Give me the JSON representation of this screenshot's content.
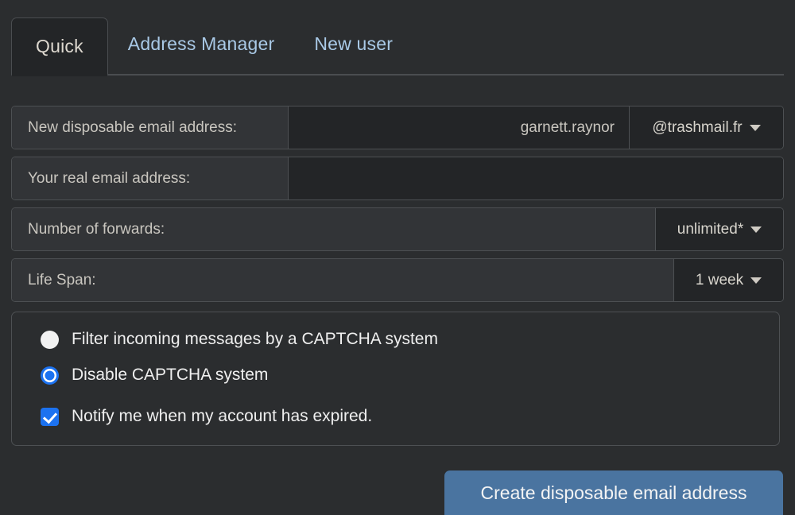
{
  "tabs": [
    {
      "label": "Quick",
      "active": true
    },
    {
      "label": "Address Manager",
      "active": false
    },
    {
      "label": "New user",
      "active": false
    }
  ],
  "form": {
    "new_address": {
      "label": "New disposable email address:",
      "value": "garnett.raynor",
      "placeholder": "",
      "domain_selected": "@trashmail.fr"
    },
    "real_address": {
      "label": "Your real email address:",
      "value": "",
      "placeholder": ""
    },
    "forwards": {
      "label": "Number of forwards:",
      "selected": "unlimited*"
    },
    "lifespan": {
      "label": "Life Span:",
      "selected": "1 week"
    }
  },
  "options": {
    "captcha_filter": {
      "label": "Filter incoming messages by a CAPTCHA system",
      "checked": false
    },
    "captcha_disable": {
      "label": "Disable CAPTCHA system",
      "checked": true
    },
    "notify_expired": {
      "label": "Notify me when my account has expired.",
      "checked": true
    }
  },
  "submit": {
    "label": "Create disposable email address"
  },
  "colors": {
    "background": "#2b2d2f",
    "panel": "#232527",
    "label_cell": "#323437",
    "border": "#4d5053",
    "link": "#a9c9e6",
    "accent_blue": "#1c72f0",
    "button_blue": "#4a74a0",
    "text": "#d8d5cd"
  },
  "icons": {
    "caret": "chevron-down-icon",
    "check": "check-icon"
  }
}
